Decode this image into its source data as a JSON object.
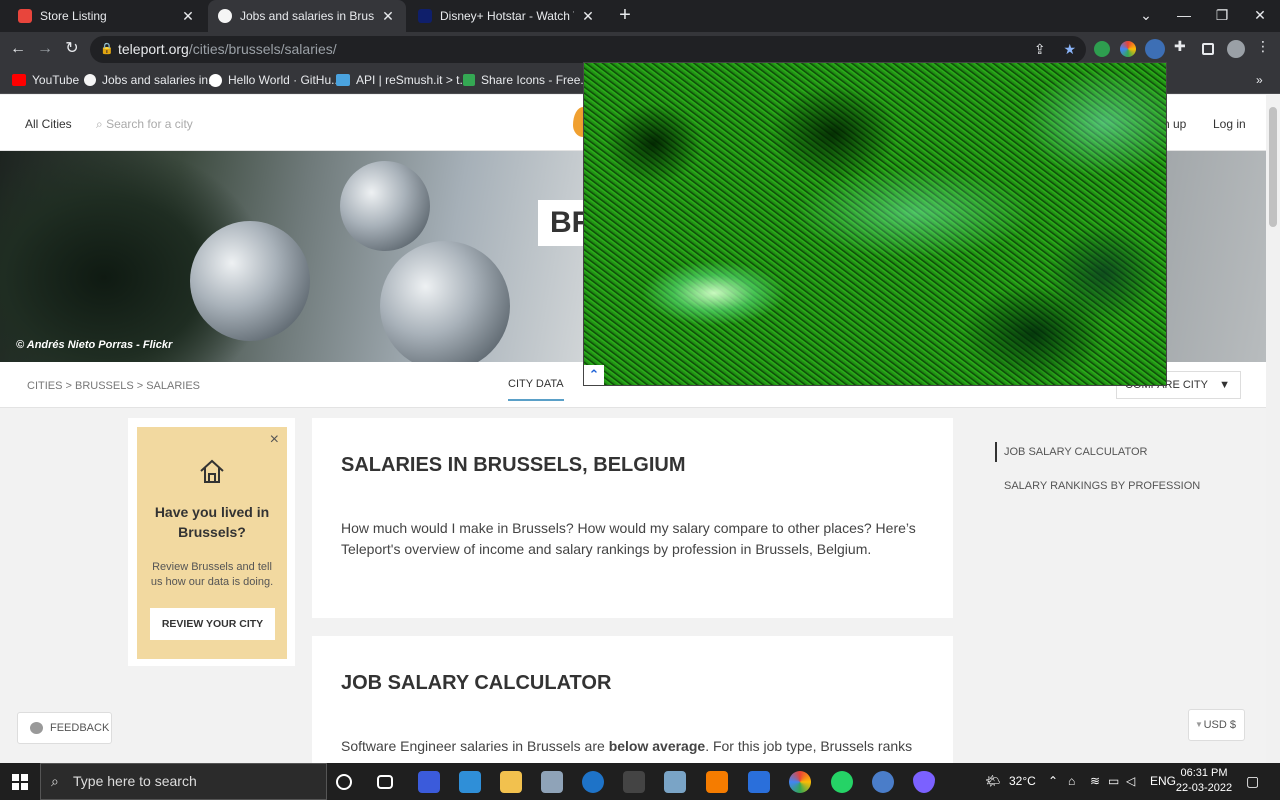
{
  "browser": {
    "tabs": [
      {
        "title": "Store Listing",
        "active": false
      },
      {
        "title": "Jobs and salaries in Brussels, Belg",
        "active": true
      },
      {
        "title": "Disney+ Hotstar - Watch TV Shov",
        "active": false
      }
    ],
    "url_host": "teleport.org",
    "url_path": "/cities/brussels/salaries/",
    "bookmarks": [
      "YouTube",
      "Jobs and salaries in...",
      "Hello World · GitHu...",
      "API | reSmush.it > t...",
      "Share Icons - Free..."
    ],
    "bookmarks_more": "»"
  },
  "site": {
    "header": {
      "all_cities": "All Cities",
      "search_placeholder": "Search for a city",
      "signup": "n up",
      "login": "Log in"
    },
    "hero": {
      "title_fragment": "BR",
      "credit": "© Andrés Nieto Porras - Flickr"
    },
    "subnav": {
      "breadcrumb": "CITIES > BRUSSELS > SALARIES",
      "city_data": "CITY DATA",
      "compare_city": "COMPARE CITY"
    },
    "promo": {
      "heading": "Have you lived in Brussels?",
      "text": "Review Brussels and tell us how our data is doing.",
      "button": "REVIEW YOUR CITY"
    },
    "section1": {
      "title": "SALARIES IN BRUSSELS, BELGIUM",
      "text": "How much would I make in Brussels? How would my salary compare to other places? Here’s Teleport's overview of income and salary rankings by profession in Brussels, Belgium."
    },
    "section2": {
      "title": "JOB SALARY CALCULATOR",
      "text_before": "Software Engineer salaries in Brussels are ",
      "text_bold": "below average",
      "text_after": ". For this job type, Brussels ranks"
    },
    "sidenav": [
      "JOB SALARY CALCULATOR",
      "SALARY RANKINGS BY PROFESSION"
    ],
    "feedback": "FEEDBACK",
    "currency": "USD $"
  },
  "taskbar": {
    "search_placeholder": "Type here to search",
    "temperature": "32°C",
    "language": "ENG",
    "time": "06:31 PM",
    "date": "22-03-2022"
  }
}
